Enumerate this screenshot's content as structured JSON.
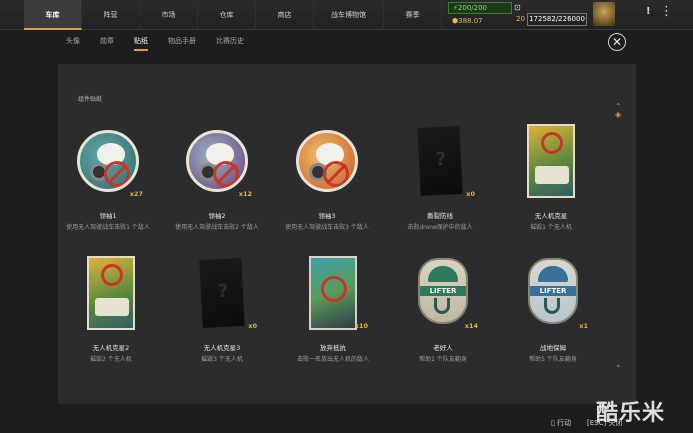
{
  "topnav": {
    "tabs": [
      "车库",
      "阵营",
      "市场",
      "仓库",
      "商店",
      "战车博物馆",
      "赛季"
    ],
    "active_index": 0
  },
  "resources": {
    "fuel": "200/200",
    "coins": "388.07",
    "count": "20",
    "xp": "172582/226000"
  },
  "subnav": {
    "tabs": [
      "头像",
      "勋章",
      "贴纸",
      "物品手册",
      "比赛历史"
    ],
    "active_index": 2
  },
  "section_title": "组件贴纸",
  "stickers": [
    {
      "name": "领袖1",
      "desc": "使用无人驾驶战车击败1 个敌人",
      "qty": "x27",
      "style": "round-teal"
    },
    {
      "name": "领袖2",
      "desc": "使用无人驾驶战车击败2 个敌人",
      "qty": "x12",
      "style": "round-purple"
    },
    {
      "name": "领袖3",
      "desc": "使用无人驾驶战车击败3 个敌人",
      "qty": "",
      "style": "round-orange"
    },
    {
      "name": "撕裂防线",
      "desc": "击败drone保护中的敌人",
      "qty": "x0",
      "style": "dark"
    },
    {
      "name": "无人机克星",
      "desc": "摧毁1 个无人机",
      "qty": "",
      "style": "rect"
    },
    {
      "name": "无人机克星2",
      "desc": "摧毁2 个无人机",
      "qty": "",
      "style": "rect"
    },
    {
      "name": "无人机克星3",
      "desc": "摧毁3 个无人机",
      "qty": "x0",
      "style": "dark"
    },
    {
      "name": "放弃抵抗",
      "desc": "击败一名放出无人机的敌人",
      "qty": "x10",
      "style": "bluecard"
    },
    {
      "name": "老好人",
      "desc": "帮助1 个队友翻身",
      "qty": "x14",
      "style": "shield-green"
    },
    {
      "name": "战地保姆",
      "desc": "帮助5 个队友翻身",
      "qty": "x1",
      "style": "shield-blue"
    }
  ],
  "shield_text": "LIFTER",
  "footer": {
    "action": "行动",
    "esc": "[ESC] 关闭"
  },
  "watermark": "酷乐米"
}
